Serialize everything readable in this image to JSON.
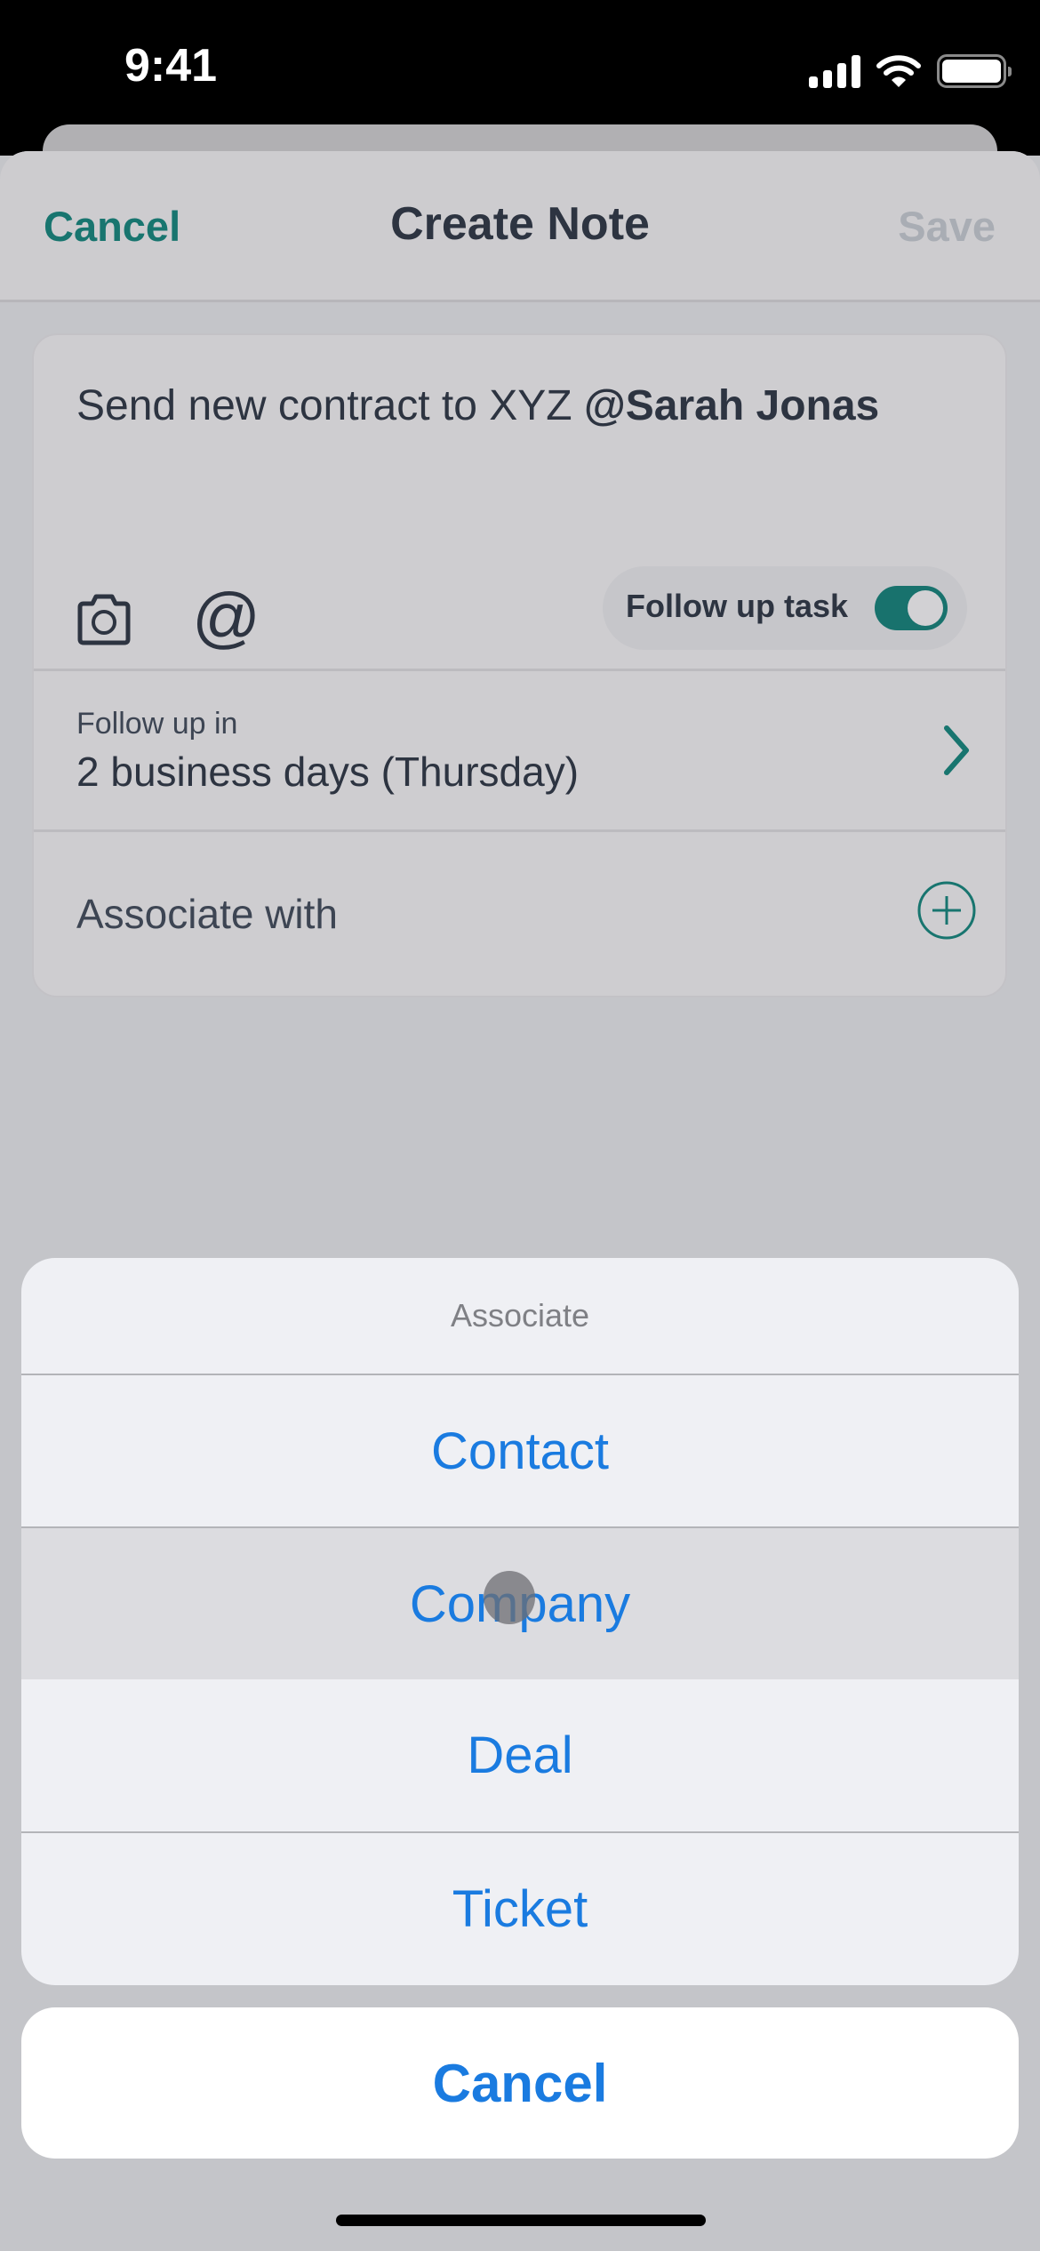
{
  "status_bar": {
    "time": "9:41",
    "icons": [
      "cellular-signal-icon",
      "wifi-icon",
      "battery-icon"
    ]
  },
  "nav": {
    "cancel_label": "Cancel",
    "title": "Create Note",
    "save_label": "Save"
  },
  "note": {
    "text": "Send new contract to XYZ ",
    "mention": "@Sarah Jonas",
    "icons": [
      "camera-icon",
      "at-mention-icon"
    ],
    "follow_up_task_label": "Follow up task",
    "follow_up_task_enabled": true
  },
  "follow_up": {
    "label": "Follow up in",
    "value": "2 business days (Thursday)"
  },
  "associate_with": {
    "label": "Associate with"
  },
  "action_sheet": {
    "title": "Associate",
    "options": [
      "Contact",
      "Company",
      "Deal",
      "Ticket"
    ],
    "pressed_option": "Company",
    "cancel_label": "Cancel"
  },
  "colors": {
    "brand_teal": "#18756f",
    "ios_blue": "#1a7be0",
    "text_dark": "#2d3441",
    "save_disabled": "#a9adb4"
  }
}
